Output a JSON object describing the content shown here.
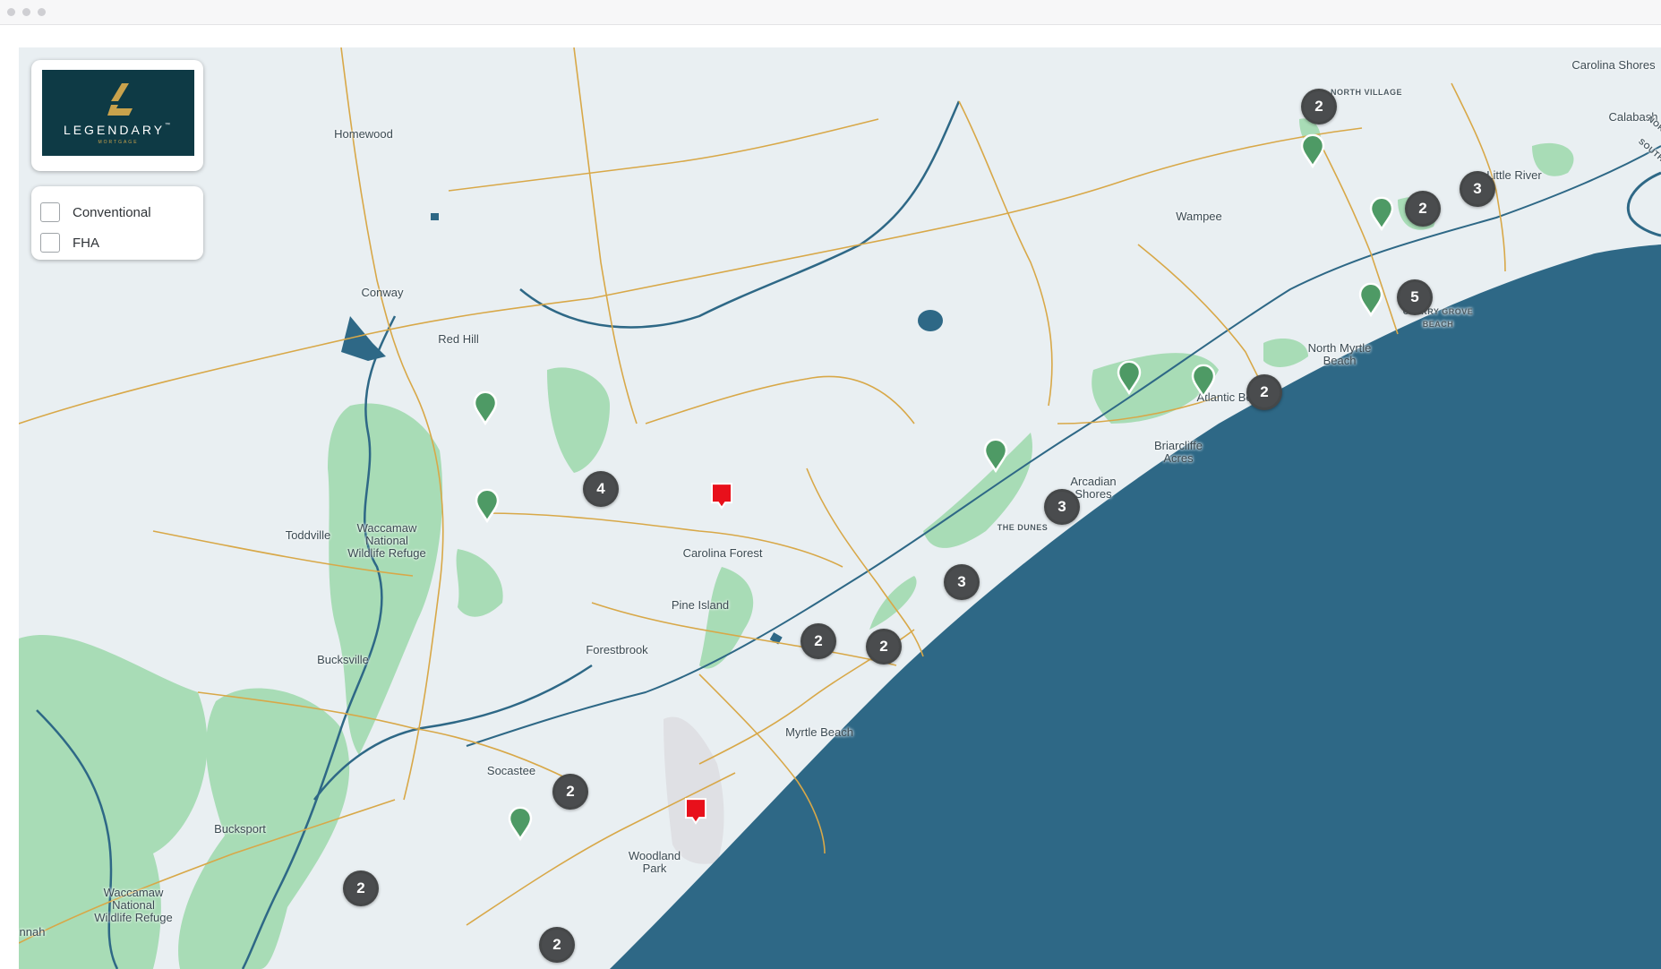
{
  "window": {
    "controls": [
      "close",
      "minimize",
      "maximize"
    ]
  },
  "logo": {
    "name": "LEGENDARY",
    "trademark": "™",
    "subtitle": "MORTGAGE",
    "colors": {
      "background": "#0e3a45",
      "accent": "#c9a24c"
    }
  },
  "filters": [
    {
      "label": "Conventional",
      "checked": false
    },
    {
      "label": "FHA",
      "checked": false
    }
  ],
  "map": {
    "colors": {
      "land": "#e9eff2",
      "water": "#2e6886",
      "park": "#a8dcb6",
      "road": "#d8a848",
      "airport": "#dfe0e4"
    },
    "places": [
      {
        "name": "Carolina Shores"
      },
      {
        "name": "Calabash"
      },
      {
        "name": "NORTH VILLAGE"
      },
      {
        "name": "Homewood"
      },
      {
        "name": "Little River"
      },
      {
        "name": "Wampee"
      },
      {
        "name": "NORTH CAROLINA"
      },
      {
        "name": "SOUTH CAROLINA"
      },
      {
        "name": "Conway"
      },
      {
        "name": "Red Hill"
      },
      {
        "name": "CHERRY GROVE BEACH"
      },
      {
        "name": "North Myrtle Beach"
      },
      {
        "name": "Atlantic Beach"
      },
      {
        "name": "Briarcliffe Acres"
      },
      {
        "name": "Waccamaw National Wildlife Refuge"
      },
      {
        "name": "Arcadian Shores"
      },
      {
        "name": "THE DUNES"
      },
      {
        "name": "Toddville"
      },
      {
        "name": "Carolina Forest"
      },
      {
        "name": "Pine Island"
      },
      {
        "name": "Forestbrook"
      },
      {
        "name": "Bucksville"
      },
      {
        "name": "Myrtle Beach"
      },
      {
        "name": "Socastee"
      },
      {
        "name": "Bucksport"
      },
      {
        "name": "Woodland Park"
      },
      {
        "name": "Waccamaw National Wildlife Refuge"
      },
      {
        "name": "nnah"
      }
    ],
    "clusters": [
      {
        "count": "2"
      },
      {
        "count": "3"
      },
      {
        "count": "2"
      },
      {
        "count": "5"
      },
      {
        "count": "2"
      },
      {
        "count": "4"
      },
      {
        "count": "3"
      },
      {
        "count": "3"
      },
      {
        "count": "2"
      },
      {
        "count": "2"
      },
      {
        "count": "2"
      },
      {
        "count": "2"
      },
      {
        "count": "2"
      }
    ],
    "pins": [
      {
        "type": "green-location-pin"
      },
      {
        "type": "green-location-pin"
      },
      {
        "type": "green-location-pin"
      },
      {
        "type": "green-location-pin"
      },
      {
        "type": "green-location-pin"
      },
      {
        "type": "green-location-pin"
      },
      {
        "type": "green-location-pin"
      },
      {
        "type": "green-location-pin"
      },
      {
        "type": "green-location-pin"
      }
    ],
    "flags": [
      {
        "type": "red-flag-marker"
      },
      {
        "type": "red-flag-marker"
      }
    ]
  }
}
